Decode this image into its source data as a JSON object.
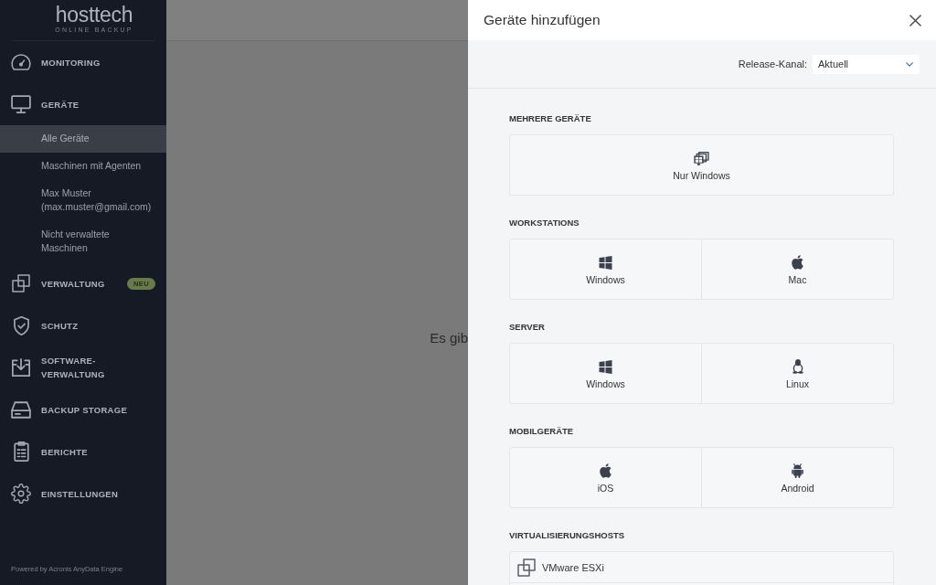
{
  "sidebar": {
    "logo": {
      "wordmark": "hosttech",
      "tagline": "ONLINE BACKUP"
    },
    "items": [
      {
        "label": "MONITORING"
      },
      {
        "label": "GERÄTE",
        "children": [
          {
            "label": "Alle Geräte",
            "selected": true
          },
          {
            "label": "Maschinen mit Agenten",
            "selected": false
          },
          {
            "label": "Max Muster (max.muster@gmail.com)",
            "selected": false
          },
          {
            "label": "Nicht verwaltete Maschinen",
            "selected": false
          }
        ]
      },
      {
        "label": "VERWALTUNG",
        "badge": "NEU"
      },
      {
        "label": "SCHUTZ"
      },
      {
        "label": "SOFTWARE-VERWALTUNG"
      },
      {
        "label": "BACKUP STORAGE"
      },
      {
        "label": "BERICHTE"
      },
      {
        "label": "EINSTELLUNGEN"
      }
    ],
    "footer": "Powered by Acronis AnyData Engine"
  },
  "main": {
    "message": "Es gib"
  },
  "panel": {
    "title": "Geräte hinzufügen",
    "release_channel": {
      "label": "Release-Kanal:",
      "value": "Aktuell"
    },
    "sections": [
      {
        "title": "MEHRERE GERÄTE",
        "kind": "tiles",
        "items": [
          {
            "label": "Nur Windows"
          }
        ]
      },
      {
        "title": "WORKSTATIONS",
        "kind": "tiles",
        "items": [
          {
            "label": "Windows"
          },
          {
            "label": "Mac"
          }
        ]
      },
      {
        "title": "SERVER",
        "kind": "tiles",
        "items": [
          {
            "label": "Windows"
          },
          {
            "label": "Linux"
          }
        ]
      },
      {
        "title": "MOBILGERÄTE",
        "kind": "tiles",
        "items": [
          {
            "label": "iOS"
          },
          {
            "label": "Android"
          }
        ]
      },
      {
        "title": "VIRTUALISIERUNGSHOSTS",
        "kind": "list",
        "items": [
          {
            "label": "VMware ESXi"
          }
        ]
      }
    ]
  }
}
